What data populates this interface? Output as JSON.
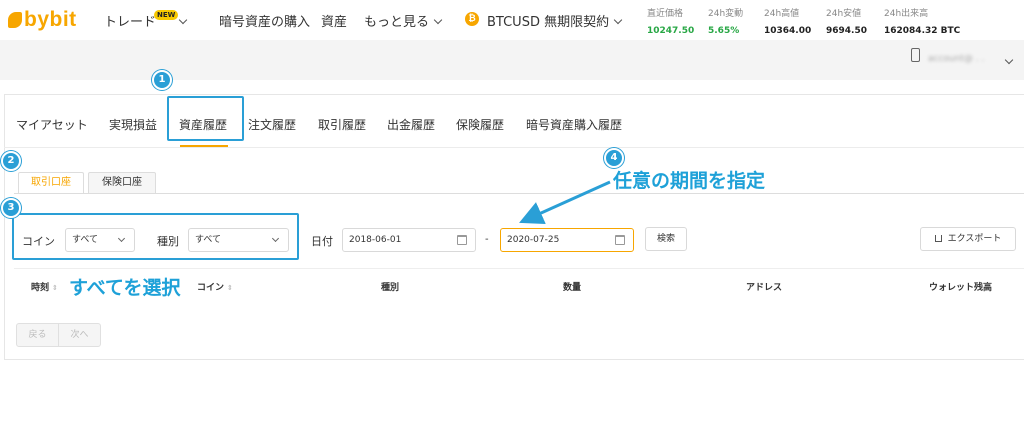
{
  "brand": {
    "logo_text": "bybit"
  },
  "nav": {
    "trade_label": "トレード",
    "trade_badge": "NEW",
    "buy_crypto_label": "暗号資産の購入",
    "assets_label": "資産",
    "more_label": "もっと見る",
    "contract_coin_glyph": "₿",
    "contract_label": "BTCUSD 無期限契約"
  },
  "stats": [
    {
      "label": "直近価格",
      "value": "10247.50",
      "color": "#28a745"
    },
    {
      "label": "24h変動",
      "value": "5.65%",
      "color": "#28a745"
    },
    {
      "label": "24h高値",
      "value": "10364.00",
      "color": "#222222"
    },
    {
      "label": "24h安値",
      "value": "9694.50",
      "color": "#222222"
    },
    {
      "label": "24h出来高",
      "value": "162084.32 BTC",
      "color": "#222222"
    }
  ],
  "account": {
    "name": "account@ . ."
  },
  "tabs": [
    "マイアセット",
    "実現損益",
    "資産履歴",
    "注文履歴",
    "取引履歴",
    "出金履歴",
    "保険履歴",
    "暗号資産購入履歴"
  ],
  "active_tab": "資産履歴",
  "subtabs": [
    "取引口座",
    "保険口座"
  ],
  "filters": {
    "coin_label": "コイン",
    "coin_value": "すべて",
    "type_label": "種別",
    "type_value": "すべて",
    "date_label": "日付",
    "date_from": "2018-06-01",
    "date_to": "2020-07-25",
    "date_sep": "-",
    "search_label": "検索",
    "export_label": "エクスポート"
  },
  "table": {
    "headers": [
      "時刻",
      "コイン",
      "種別",
      "数量",
      "アドレス",
      "ウォレット残高"
    ],
    "sort_glyph": "⇕"
  },
  "pagination": {
    "prev_label": "戻る",
    "next_label": "次へ"
  },
  "annotations": {
    "step_numbers": [
      "1",
      "2",
      "3",
      "4"
    ],
    "select_all_text": "すべてを選択",
    "period_text": "任意の期間を指定",
    "accent_color": "#2a9fd6"
  }
}
